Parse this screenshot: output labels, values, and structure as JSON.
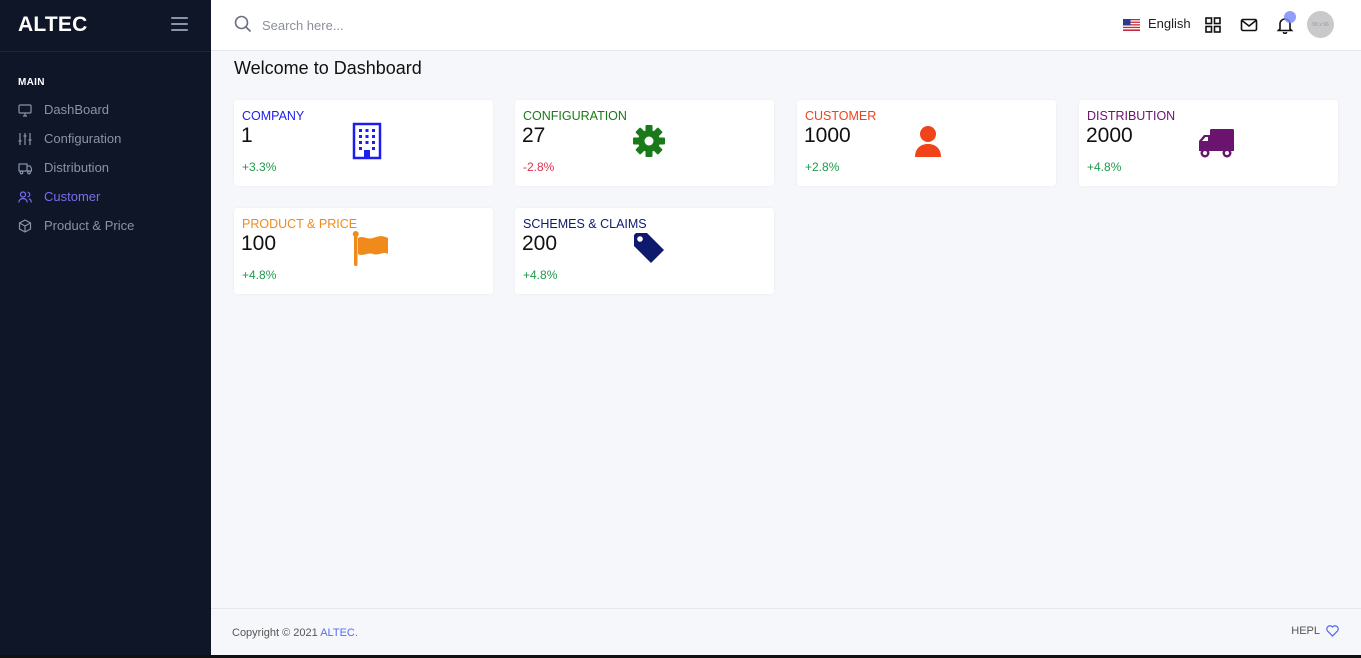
{
  "sidebar": {
    "brand": "ALTEC",
    "section_label": "MAIN",
    "items": [
      {
        "label": "DashBoard",
        "icon": "monitor-icon",
        "active": false
      },
      {
        "label": "Configuration",
        "icon": "sliders-icon",
        "active": false
      },
      {
        "label": "Distribution",
        "icon": "truck-icon",
        "active": false
      },
      {
        "label": "Customer",
        "icon": "users-icon",
        "active": true
      },
      {
        "label": "Product & Price",
        "icon": "box-icon",
        "active": false
      }
    ],
    "active_color": "#7c6cf2"
  },
  "header": {
    "search_placeholder": "Search here...",
    "language": "English",
    "avatar_text": "96 x 96"
  },
  "main": {
    "title": "Welcome to Dashboard",
    "cards": [
      {
        "title": "COMPANY",
        "value": "1",
        "change": "+3.3%",
        "title_color": "#1d1df0",
        "change_color": "#1e9a4a",
        "icon": "building-icon"
      },
      {
        "title": "CONFIGURATION",
        "value": "27",
        "change": "-2.8%",
        "title_color": "#1a7a1a",
        "change_color": "#e0314b",
        "icon": "gear-icon"
      },
      {
        "title": "CUSTOMER",
        "value": "1000",
        "change": "+2.8%",
        "title_color": "#f0431a",
        "change_color": "#1e9a4a",
        "icon": "user-icon"
      },
      {
        "title": "DISTRIBUTION",
        "value": "2000",
        "change": "+4.8%",
        "title_color": "#6a1470",
        "change_color": "#1e9a4a",
        "icon": "truck-icon"
      },
      {
        "title": "PRODUCT & PRICE",
        "value": "100",
        "change": "+4.8%",
        "title_color": "#f08a1a",
        "change_color": "#1e9a4a",
        "icon": "flag-icon"
      },
      {
        "title": "SCHEMES & CLAIMS",
        "value": "200",
        "change": "+4.8%",
        "title_color": "#0e1a6e",
        "change_color": "#1e9a4a",
        "icon": "tag-icon"
      }
    ]
  },
  "footer": {
    "copyright_prefix": "Copyright © 2021 ",
    "copyright_brand": "ALTEC.",
    "right_label": "HEPL"
  }
}
